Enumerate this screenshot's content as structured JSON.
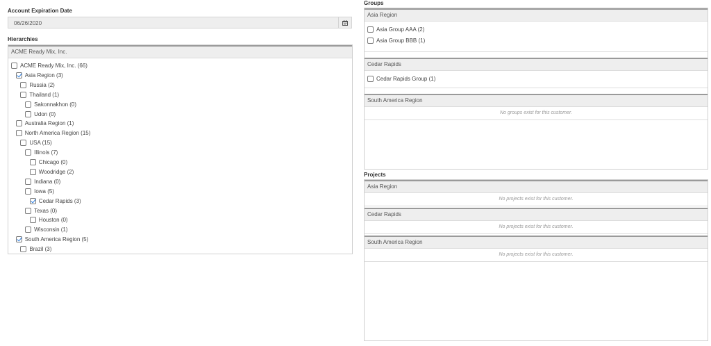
{
  "account": {
    "expiration_label": "Account Expiration Date",
    "expiration_value": "06/26/2020"
  },
  "hierarchies": {
    "label": "Hierarchies",
    "header": "ACME Ready Mix, Inc.",
    "items": [
      {
        "label": "ACME Ready Mix, Inc. (66)",
        "checked": false,
        "level": 0
      },
      {
        "label": "Asia Region (3)",
        "checked": true,
        "level": 1
      },
      {
        "label": "Russia (2)",
        "checked": false,
        "level": 2
      },
      {
        "label": "Thailand (1)",
        "checked": false,
        "level": 2
      },
      {
        "label": "Sakonnakhon (0)",
        "checked": false,
        "level": 3
      },
      {
        "label": "Udon (0)",
        "checked": false,
        "level": 3
      },
      {
        "label": "Australia Region (1)",
        "checked": false,
        "level": 1
      },
      {
        "label": "North America Region (15)",
        "checked": false,
        "level": 1
      },
      {
        "label": "USA (15)",
        "checked": false,
        "level": 2
      },
      {
        "label": "Illinois (7)",
        "checked": false,
        "level": 3
      },
      {
        "label": "Chicago (0)",
        "checked": false,
        "level": 4
      },
      {
        "label": "Woodridge (2)",
        "checked": false,
        "level": 4
      },
      {
        "label": "Indiana (0)",
        "checked": false,
        "level": 3
      },
      {
        "label": "Iowa (5)",
        "checked": false,
        "level": 3
      },
      {
        "label": "Cedar Rapids (3)",
        "checked": true,
        "level": 4
      },
      {
        "label": "Texas (0)",
        "checked": false,
        "level": 3
      },
      {
        "label": "Houston (0)",
        "checked": false,
        "level": 4
      },
      {
        "label": "Wisconsin (1)",
        "checked": false,
        "level": 3
      },
      {
        "label": "South America Region (5)",
        "checked": true,
        "level": 1
      },
      {
        "label": "Brazil (3)",
        "checked": false,
        "level": 2
      }
    ]
  },
  "groups": {
    "label": "Groups",
    "sections": [
      {
        "title": "Asia Region",
        "items": [
          {
            "label": "Asia Group AAA (2)",
            "checked": false
          },
          {
            "label": "Asia Group BBB (1)",
            "checked": false
          }
        ],
        "empty": ""
      },
      {
        "title": "Cedar Rapids",
        "items": [
          {
            "label": "Cedar Rapids Group (1)",
            "checked": false
          }
        ],
        "empty": ""
      },
      {
        "title": "South America Region",
        "items": [],
        "empty": "No groups exist for this customer."
      }
    ]
  },
  "projects": {
    "label": "Projects",
    "sections": [
      {
        "title": "Asia Region",
        "empty": "No projects exist for this customer."
      },
      {
        "title": "Cedar Rapids",
        "empty": "No projects exist for this customer."
      },
      {
        "title": "South America Region",
        "empty": "No projects exist for this customer."
      }
    ]
  }
}
